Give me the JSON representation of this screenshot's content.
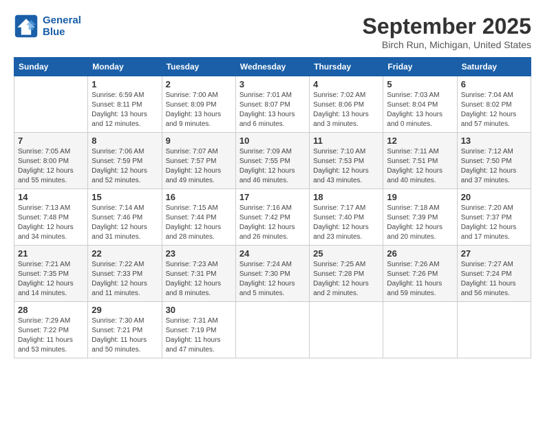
{
  "header": {
    "logo_line1": "General",
    "logo_line2": "Blue",
    "month": "September 2025",
    "location": "Birch Run, Michigan, United States"
  },
  "weekdays": [
    "Sunday",
    "Monday",
    "Tuesday",
    "Wednesday",
    "Thursday",
    "Friday",
    "Saturday"
  ],
  "weeks": [
    [
      {
        "day": "",
        "info": ""
      },
      {
        "day": "1",
        "info": "Sunrise: 6:59 AM\nSunset: 8:11 PM\nDaylight: 13 hours\nand 12 minutes."
      },
      {
        "day": "2",
        "info": "Sunrise: 7:00 AM\nSunset: 8:09 PM\nDaylight: 13 hours\nand 9 minutes."
      },
      {
        "day": "3",
        "info": "Sunrise: 7:01 AM\nSunset: 8:07 PM\nDaylight: 13 hours\nand 6 minutes."
      },
      {
        "day": "4",
        "info": "Sunrise: 7:02 AM\nSunset: 8:06 PM\nDaylight: 13 hours\nand 3 minutes."
      },
      {
        "day": "5",
        "info": "Sunrise: 7:03 AM\nSunset: 8:04 PM\nDaylight: 13 hours\nand 0 minutes."
      },
      {
        "day": "6",
        "info": "Sunrise: 7:04 AM\nSunset: 8:02 PM\nDaylight: 12 hours\nand 57 minutes."
      }
    ],
    [
      {
        "day": "7",
        "info": "Sunrise: 7:05 AM\nSunset: 8:00 PM\nDaylight: 12 hours\nand 55 minutes."
      },
      {
        "day": "8",
        "info": "Sunrise: 7:06 AM\nSunset: 7:59 PM\nDaylight: 12 hours\nand 52 minutes."
      },
      {
        "day": "9",
        "info": "Sunrise: 7:07 AM\nSunset: 7:57 PM\nDaylight: 12 hours\nand 49 minutes."
      },
      {
        "day": "10",
        "info": "Sunrise: 7:09 AM\nSunset: 7:55 PM\nDaylight: 12 hours\nand 46 minutes."
      },
      {
        "day": "11",
        "info": "Sunrise: 7:10 AM\nSunset: 7:53 PM\nDaylight: 12 hours\nand 43 minutes."
      },
      {
        "day": "12",
        "info": "Sunrise: 7:11 AM\nSunset: 7:51 PM\nDaylight: 12 hours\nand 40 minutes."
      },
      {
        "day": "13",
        "info": "Sunrise: 7:12 AM\nSunset: 7:50 PM\nDaylight: 12 hours\nand 37 minutes."
      }
    ],
    [
      {
        "day": "14",
        "info": "Sunrise: 7:13 AM\nSunset: 7:48 PM\nDaylight: 12 hours\nand 34 minutes."
      },
      {
        "day": "15",
        "info": "Sunrise: 7:14 AM\nSunset: 7:46 PM\nDaylight: 12 hours\nand 31 minutes."
      },
      {
        "day": "16",
        "info": "Sunrise: 7:15 AM\nSunset: 7:44 PM\nDaylight: 12 hours\nand 28 minutes."
      },
      {
        "day": "17",
        "info": "Sunrise: 7:16 AM\nSunset: 7:42 PM\nDaylight: 12 hours\nand 26 minutes."
      },
      {
        "day": "18",
        "info": "Sunrise: 7:17 AM\nSunset: 7:40 PM\nDaylight: 12 hours\nand 23 minutes."
      },
      {
        "day": "19",
        "info": "Sunrise: 7:18 AM\nSunset: 7:39 PM\nDaylight: 12 hours\nand 20 minutes."
      },
      {
        "day": "20",
        "info": "Sunrise: 7:20 AM\nSunset: 7:37 PM\nDaylight: 12 hours\nand 17 minutes."
      }
    ],
    [
      {
        "day": "21",
        "info": "Sunrise: 7:21 AM\nSunset: 7:35 PM\nDaylight: 12 hours\nand 14 minutes."
      },
      {
        "day": "22",
        "info": "Sunrise: 7:22 AM\nSunset: 7:33 PM\nDaylight: 12 hours\nand 11 minutes."
      },
      {
        "day": "23",
        "info": "Sunrise: 7:23 AM\nSunset: 7:31 PM\nDaylight: 12 hours\nand 8 minutes."
      },
      {
        "day": "24",
        "info": "Sunrise: 7:24 AM\nSunset: 7:30 PM\nDaylight: 12 hours\nand 5 minutes."
      },
      {
        "day": "25",
        "info": "Sunrise: 7:25 AM\nSunset: 7:28 PM\nDaylight: 12 hours\nand 2 minutes."
      },
      {
        "day": "26",
        "info": "Sunrise: 7:26 AM\nSunset: 7:26 PM\nDaylight: 11 hours\nand 59 minutes."
      },
      {
        "day": "27",
        "info": "Sunrise: 7:27 AM\nSunset: 7:24 PM\nDaylight: 11 hours\nand 56 minutes."
      }
    ],
    [
      {
        "day": "28",
        "info": "Sunrise: 7:29 AM\nSunset: 7:22 PM\nDaylight: 11 hours\nand 53 minutes."
      },
      {
        "day": "29",
        "info": "Sunrise: 7:30 AM\nSunset: 7:21 PM\nDaylight: 11 hours\nand 50 minutes."
      },
      {
        "day": "30",
        "info": "Sunrise: 7:31 AM\nSunset: 7:19 PM\nDaylight: 11 hours\nand 47 minutes."
      },
      {
        "day": "",
        "info": ""
      },
      {
        "day": "",
        "info": ""
      },
      {
        "day": "",
        "info": ""
      },
      {
        "day": "",
        "info": ""
      }
    ]
  ]
}
